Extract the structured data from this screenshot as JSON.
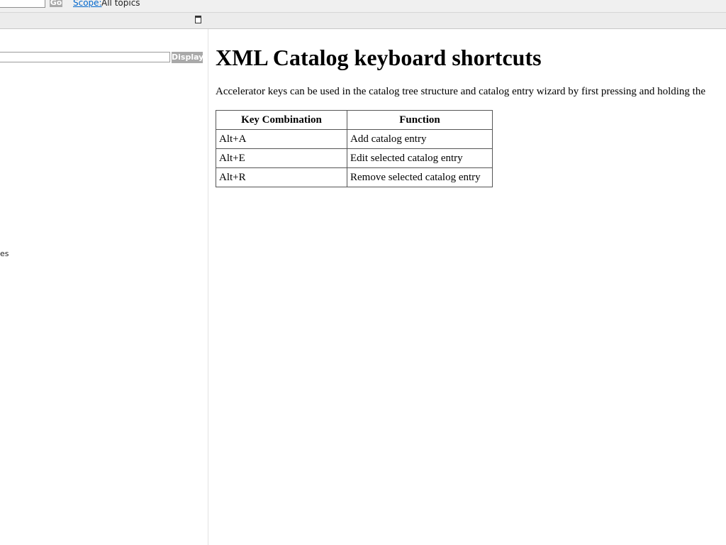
{
  "topbar": {
    "search_value": "",
    "go_label": "Go",
    "scope_label": "Scope:",
    "scope_value": "All topics"
  },
  "toolbar": {
    "maximize_icon": "maximize-icon"
  },
  "left_pane": {
    "index_value": "",
    "display_label": "Display",
    "fragment_text": "es"
  },
  "content": {
    "title": "XML Catalog keyboard shortcuts",
    "intro": "Accelerator keys can be used in the catalog tree structure and catalog entry wizard by first pressing and holding the",
    "table": {
      "headers": [
        "Key Combination",
        "Function"
      ],
      "rows": [
        [
          "Alt+A",
          "Add catalog entry"
        ],
        [
          "Alt+E",
          "Edit selected catalog entry"
        ],
        [
          "Alt+R",
          "Remove selected catalog entry"
        ]
      ]
    }
  }
}
